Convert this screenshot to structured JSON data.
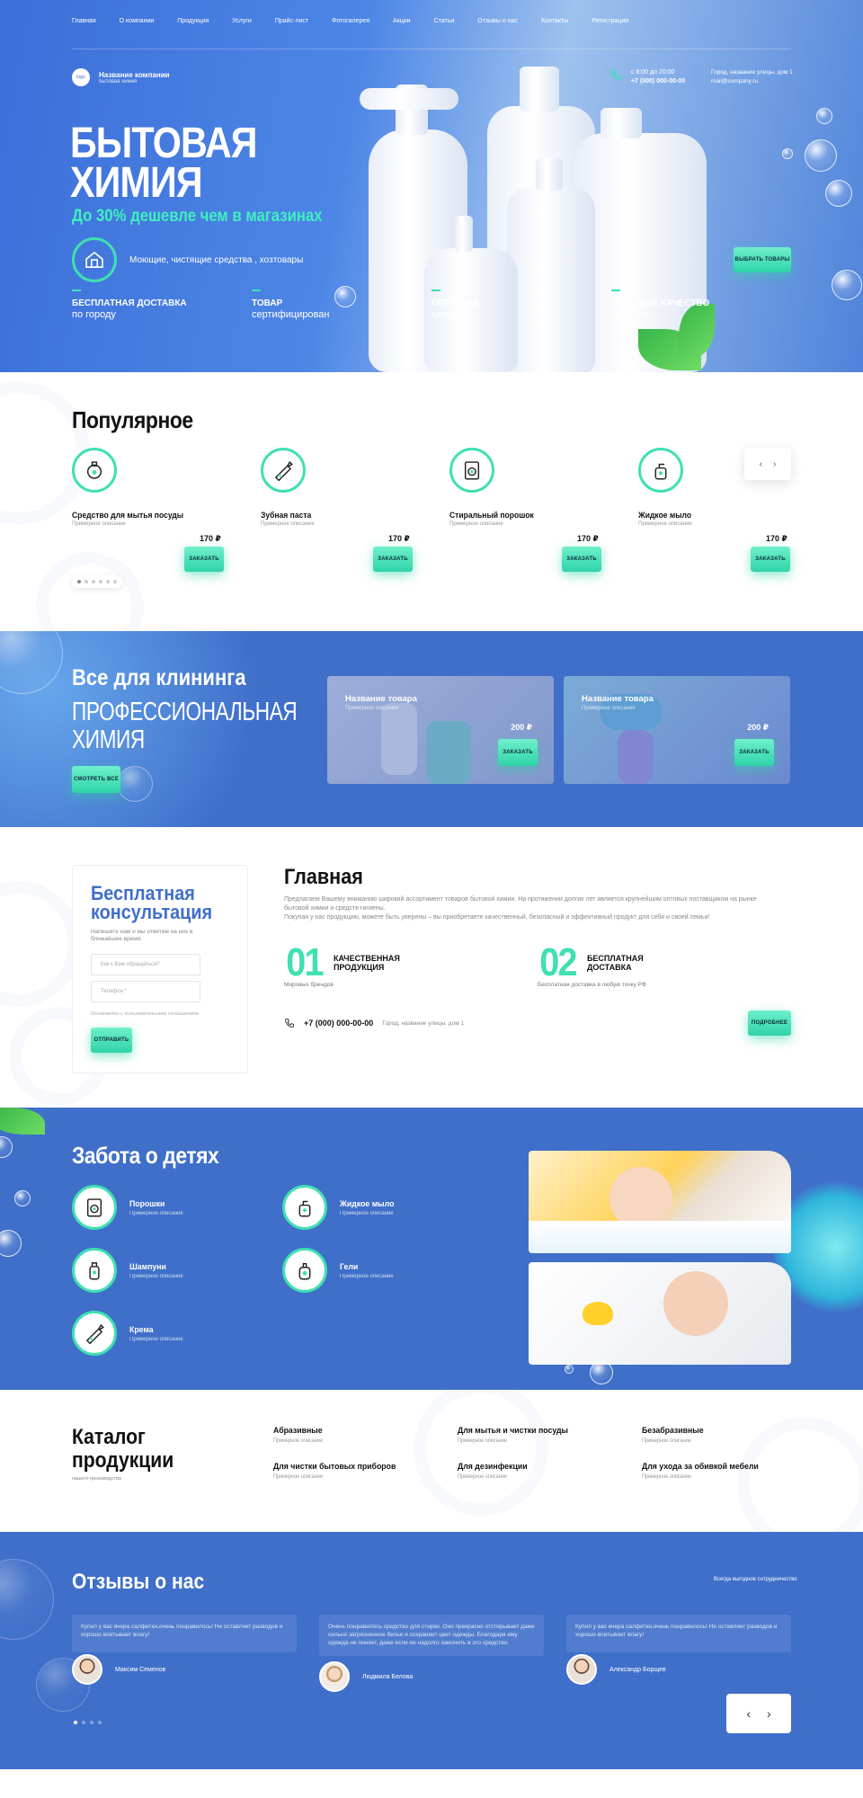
{
  "nav": [
    "Главная",
    "О компании",
    "Продукция",
    "Услуги",
    "Прайс-лист",
    "Фотогалерея",
    "Акции",
    "Статьи",
    "Отзывы о нас",
    "Контакты",
    "Регистрация"
  ],
  "logo": {
    "mark": "logo",
    "name": "Название компании",
    "tagline": "бытовая химия"
  },
  "contacts": {
    "hours": "с 8:00 до 20:00",
    "phone": "+7 (000) 000-00-00",
    "address": "Город, название улицы, дом 1",
    "email": "mail@company.ru"
  },
  "hero": {
    "title_line1": "БЫТОВАЯ",
    "title_line2": "ХИМИЯ",
    "subtitle": "До 30% дешевле чем в магазинах",
    "category_text": "Моющие, чистящие средства , хозтовары",
    "cta": "Выбрать товары",
    "features": [
      {
        "title": "Бесплатная доставка",
        "text": "по городу"
      },
      {
        "title": "Товар",
        "text": "сертифицирован"
      },
      {
        "title": "Оптовые",
        "text": "цены"
      },
      {
        "title": "Высокое качество",
        "text": "качество"
      }
    ]
  },
  "popular": {
    "title": "Популярное",
    "items": [
      {
        "name": "Средство для мытья посуды",
        "desc": "Примерное описание",
        "price": "170 ₽",
        "button": "Заказать",
        "icon": "dish-soap-icon"
      },
      {
        "name": "Зубная паста",
        "desc": "Примерное описание",
        "price": "170 ₽",
        "button": "Заказать",
        "icon": "toothpaste-icon"
      },
      {
        "name": "Стиральный порошок",
        "desc": "Примерное описание",
        "price": "170 ₽",
        "button": "Заказать",
        "icon": "washing-powder-icon"
      },
      {
        "name": "Жидкое мыло",
        "desc": "Примерное описание",
        "price": "170 ₽",
        "button": "Заказать",
        "icon": "liquid-soap-icon"
      }
    ]
  },
  "cleaning": {
    "title": "Все для клининга",
    "subtitle_line1": "ПРОФЕССИОНАЛЬНАЯ",
    "subtitle_line2": "ХИМИЯ",
    "see_all": "Смотреть все",
    "cards": [
      {
        "name": "Название товара",
        "desc": "Примерное описание",
        "price": "200 ₽",
        "button": "Заказать"
      },
      {
        "name": "Название товара",
        "desc": "Примерное описание",
        "price": "200 ₽",
        "button": "Заказать"
      }
    ]
  },
  "consult": {
    "title_line1": "Бесплатная",
    "title_line2": "консультация",
    "subtitle": "Напишите нам и мы ответим на них в ближайшее время.",
    "name_placeholder": "Как к Вам обращаться?",
    "phone_placeholder": "Телефон *",
    "agreement": "Ознакомлен с пользовательским соглашением",
    "send": "Отправить"
  },
  "main": {
    "title": "Главная",
    "text1": "Предлагаем Вашему вниманию широкий ассортимент товаров бытовой химии. На протяжении долгих лет является крупнейшим оптовых поставщиком на рынке бытовой химии и средств гигиены.",
    "text2": "Покупая у нас продукцию, можете быть уверены – вы приобретаете качественный, безопасный и эффективный продукт для себя и своей семьи!",
    "points": [
      {
        "num": "01",
        "label_line1": "Качественная",
        "label_line2": "продукция",
        "desc": "Мировых брендов"
      },
      {
        "num": "02",
        "label_line1": "Бесплатная",
        "label_line2": "доставка",
        "desc": "Бесплатная доставка в любую точку РФ"
      }
    ],
    "phone": "+7 (000) 000-00-00",
    "address": "Город, название улицы, дом 1",
    "more": "Подробнее"
  },
  "kids": {
    "title": "Забота о детях",
    "items": [
      {
        "name": "Порошки",
        "desc": "Примерное описание",
        "icon": "washing-machine-icon"
      },
      {
        "name": "Жидкое мыло",
        "desc": "Примерное описание",
        "icon": "liquid-soap-icon"
      },
      {
        "name": "Шампуни",
        "desc": "Примерное описание",
        "icon": "shampoo-icon"
      },
      {
        "name": "Гели",
        "desc": "Примерное описание",
        "icon": "gel-bottle-icon"
      },
      {
        "name": "Крема",
        "desc": "Примерное описание",
        "icon": "cream-tube-icon"
      }
    ]
  },
  "catalog": {
    "title_line1": "Каталог",
    "title_line2": "продукции",
    "subtitle": "нашего производства",
    "items": [
      {
        "name": "Абразивные",
        "desc": "Примерное описание"
      },
      {
        "name": "Для мытья и чистки посуды",
        "desc": "Примерное описание"
      },
      {
        "name": "Безабразивные",
        "desc": "Примерное описание"
      },
      {
        "name": "Для чистки бытовых приборов",
        "desc": "Примерное описание"
      },
      {
        "name": "Для дезинфекции",
        "desc": "Примерное описание"
      },
      {
        "name": "Для ухода за обивкой мебели",
        "desc": "Примерное описание"
      }
    ]
  },
  "reviews": {
    "title": "Отзывы о нас",
    "link": "Всегда выгодное сотрудничество",
    "items": [
      {
        "text": "Купил у вас вчера салфетки,очень понравилось! Не оставляет разводов и хорошо впитывает влагу!",
        "author": "Максим Семенов"
      },
      {
        "text": "Очень понравилось средство для стирки. Оно прекрасно отстирывает даже сильно загрязненное белье и сохраняет цвет одежды. Благодаря ему одежда не линяет, даже если ее надолго замочить в это средство.",
        "author": "Людмила Белова"
      },
      {
        "text": "Купил у вас вчера салфетки,очень понравилось! Не оставляет разводов и хорошо впитывает влагу!",
        "author": "Александр Борщев"
      }
    ]
  },
  "colors": {
    "accent": "#3fe0b2",
    "brand_blue": "#3f6fc9"
  }
}
